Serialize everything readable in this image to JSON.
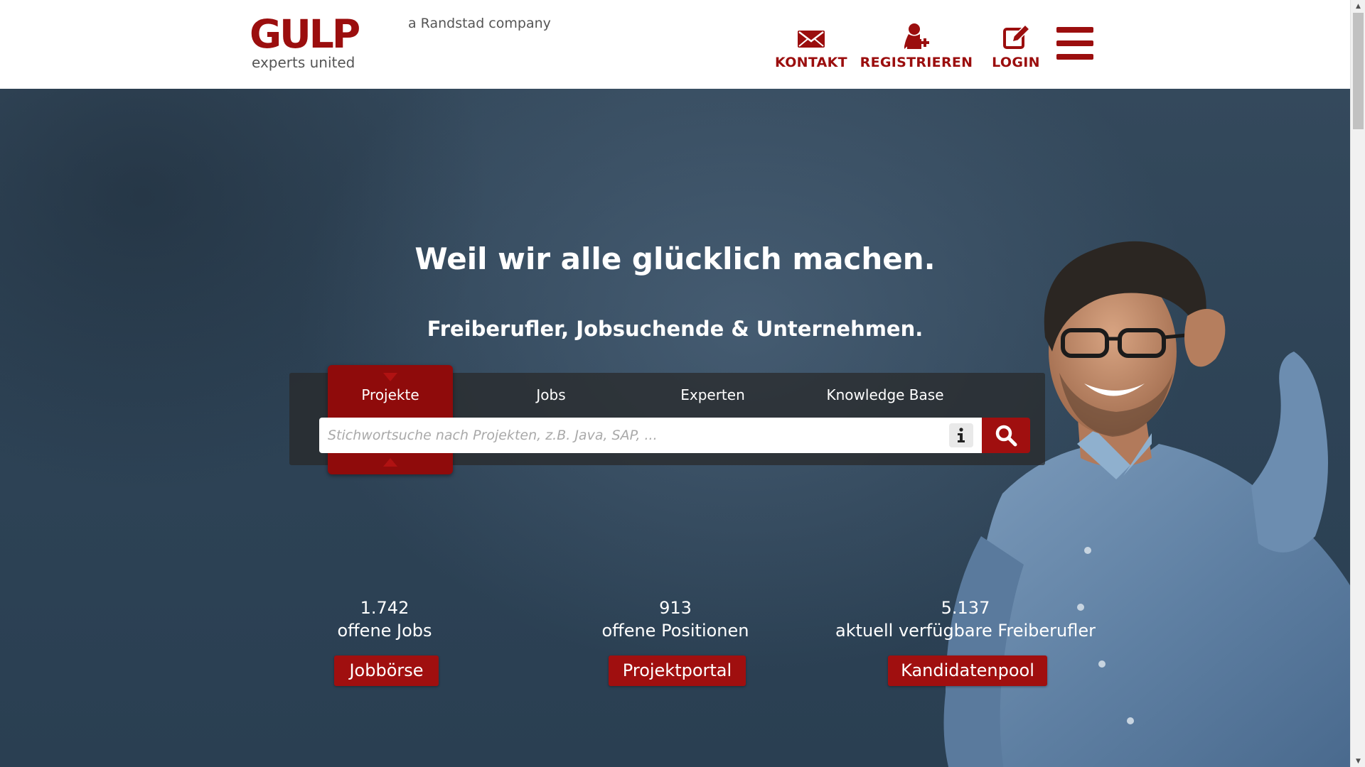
{
  "header": {
    "logo_text": "GULP",
    "logo_subtext": "experts united",
    "tagline": "a Randstad company",
    "nav": [
      {
        "label": "KONTAKT",
        "icon": "envelope-icon"
      },
      {
        "label": "REGISTRIEREN",
        "icon": "add-user-icon"
      },
      {
        "label": "LOGIN",
        "icon": "edit-icon"
      }
    ],
    "menu_icon": "hamburger-menu-icon"
  },
  "hero": {
    "title": "Weil wir alle glücklich machen.",
    "subtitle": "Freiberufler, Jobsuchende & Unternehmen."
  },
  "search": {
    "tabs": [
      {
        "label": "Projekte",
        "active": true
      },
      {
        "label": "Jobs",
        "active": false
      },
      {
        "label": "Experten",
        "active": false
      },
      {
        "label": "Knowledge Base",
        "active": false
      }
    ],
    "placeholder": "Stichwortsuche nach Projekten, z.B. Java, SAP, ...",
    "value": "",
    "info_icon": "info-icon",
    "search_icon": "search-icon"
  },
  "stats": [
    {
      "number": "1.742",
      "label": "offene Jobs",
      "button": "Jobbörse"
    },
    {
      "number": "913",
      "label": "offene Positionen",
      "button": "Projektportal"
    },
    {
      "number": "5.137",
      "label": "aktuell verfügbare Freiberufler",
      "button": "Kandidatenpool"
    }
  ],
  "colors": {
    "brand_red": "#9b0e0e",
    "button_red": "#a00f0f",
    "hero_background": "#2e4356",
    "search_panel": "#282828"
  }
}
